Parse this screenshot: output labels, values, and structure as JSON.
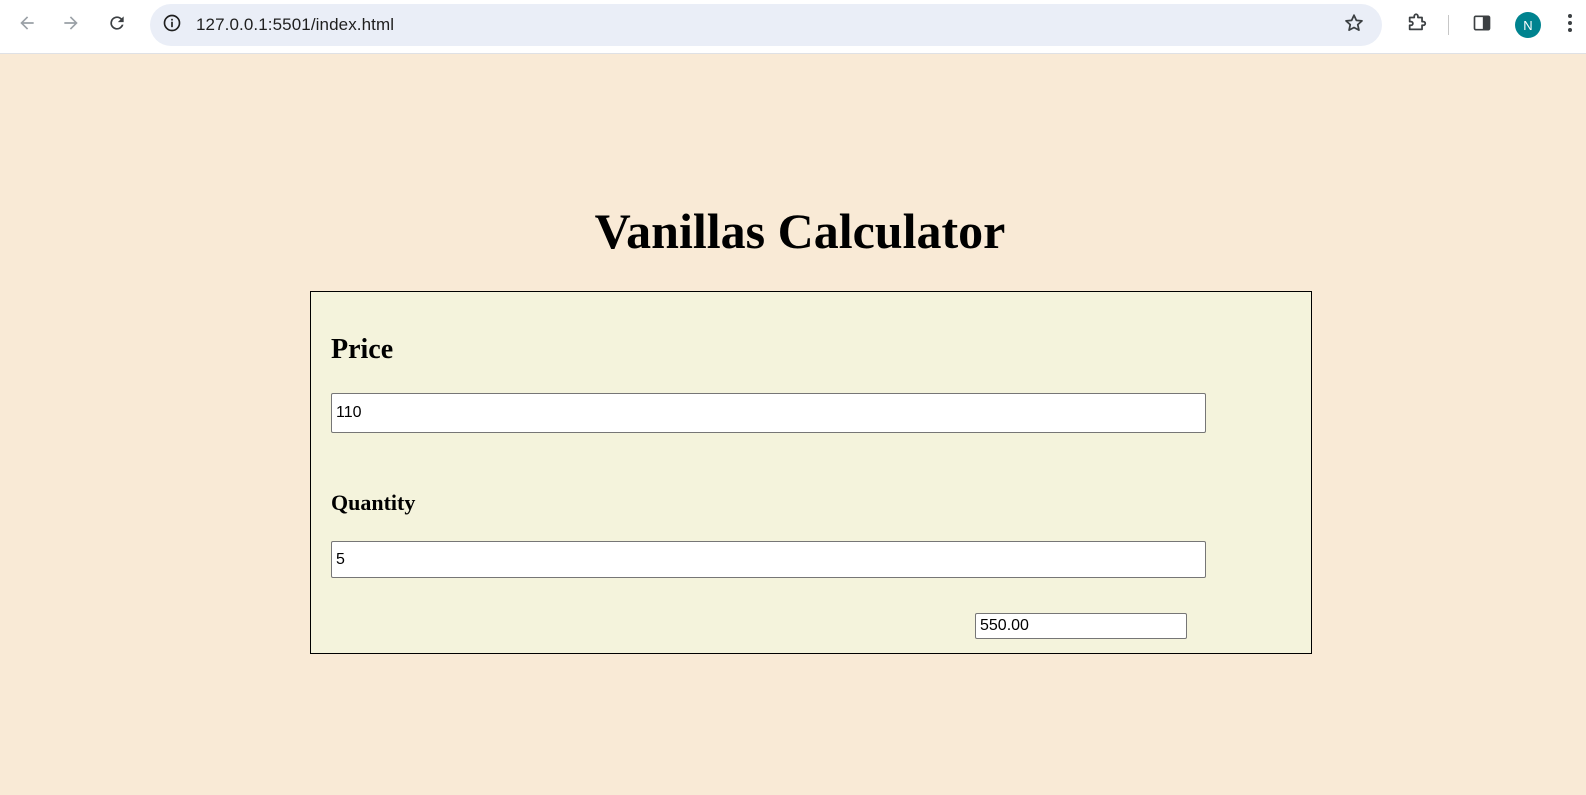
{
  "browser": {
    "url": "127.0.0.1:5501/index.html",
    "profile_initial": "N",
    "profile_color": "#00838f",
    "icons": {
      "back": "arrow-left-icon",
      "forward": "arrow-right-icon",
      "reload": "reload-icon",
      "site_info": "info-icon",
      "bookmark": "star-icon",
      "extensions": "puzzle-icon",
      "side_panel": "side-panel-icon",
      "menu": "kebab-menu-icon"
    }
  },
  "page": {
    "background": "#f9ead6",
    "title": "Vanillas Calculator",
    "form": {
      "background": "#f4f3dc",
      "price_label": "Price",
      "price_value": "110",
      "quantity_label": "Quantity",
      "quantity_value": "5",
      "total_value": "550.00"
    }
  }
}
